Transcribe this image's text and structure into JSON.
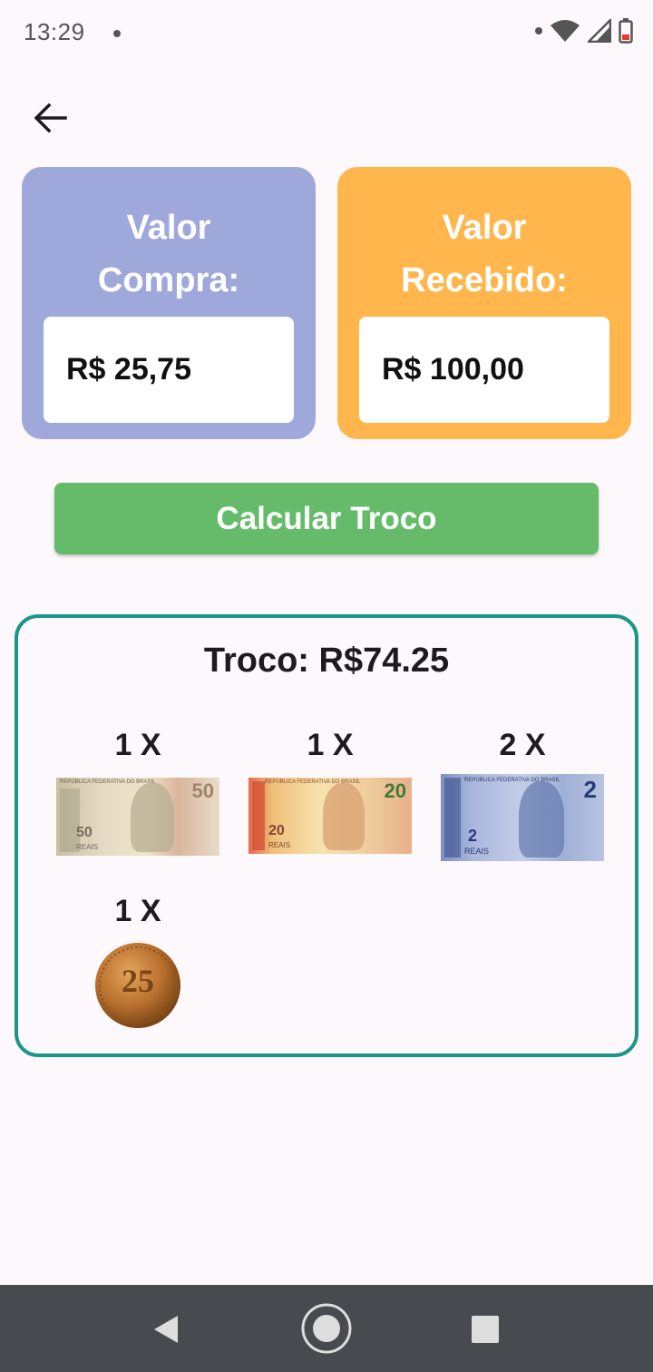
{
  "status_bar": {
    "time": "13:29"
  },
  "header": {
    "back_icon": "arrow-left-icon"
  },
  "compra": {
    "title_line1": "Valor",
    "title_line2": "Compra:",
    "value": "R$ 25,75",
    "color": "#9fa8da"
  },
  "recebido": {
    "title_line1": "Valor",
    "title_line2": "Recebido:",
    "value": "R$ 100,00",
    "color": "#ffb74d"
  },
  "calculate_button": {
    "label": "Calcular Troco",
    "color": "#66bb6a"
  },
  "result": {
    "title": "Troco: R$74.25",
    "border_color": "#1a9688",
    "items": [
      {
        "count": "1 X",
        "denomination": "50",
        "currency_label": "REAIS",
        "note_header": "REPÚBLICA FEDERATIVA DO BRASIL",
        "kind": "note-50"
      },
      {
        "count": "1 X",
        "denomination": "20",
        "currency_label": "REAIS",
        "note_header": "REPÚBLICA FEDERATIVA DO BRASIL",
        "kind": "note-20"
      },
      {
        "count": "2 X",
        "denomination": "2",
        "currency_label": "REAIS",
        "note_header": "REPÚBLICA FEDERATIVA DO BRASIL",
        "kind": "note-2"
      },
      {
        "count": "1 X",
        "denomination": "25",
        "kind": "coin-25"
      }
    ]
  },
  "nav_bar": {
    "back_icon": "triangle-back-icon",
    "home_icon": "circle-home-icon",
    "recents_icon": "square-recents-icon"
  }
}
